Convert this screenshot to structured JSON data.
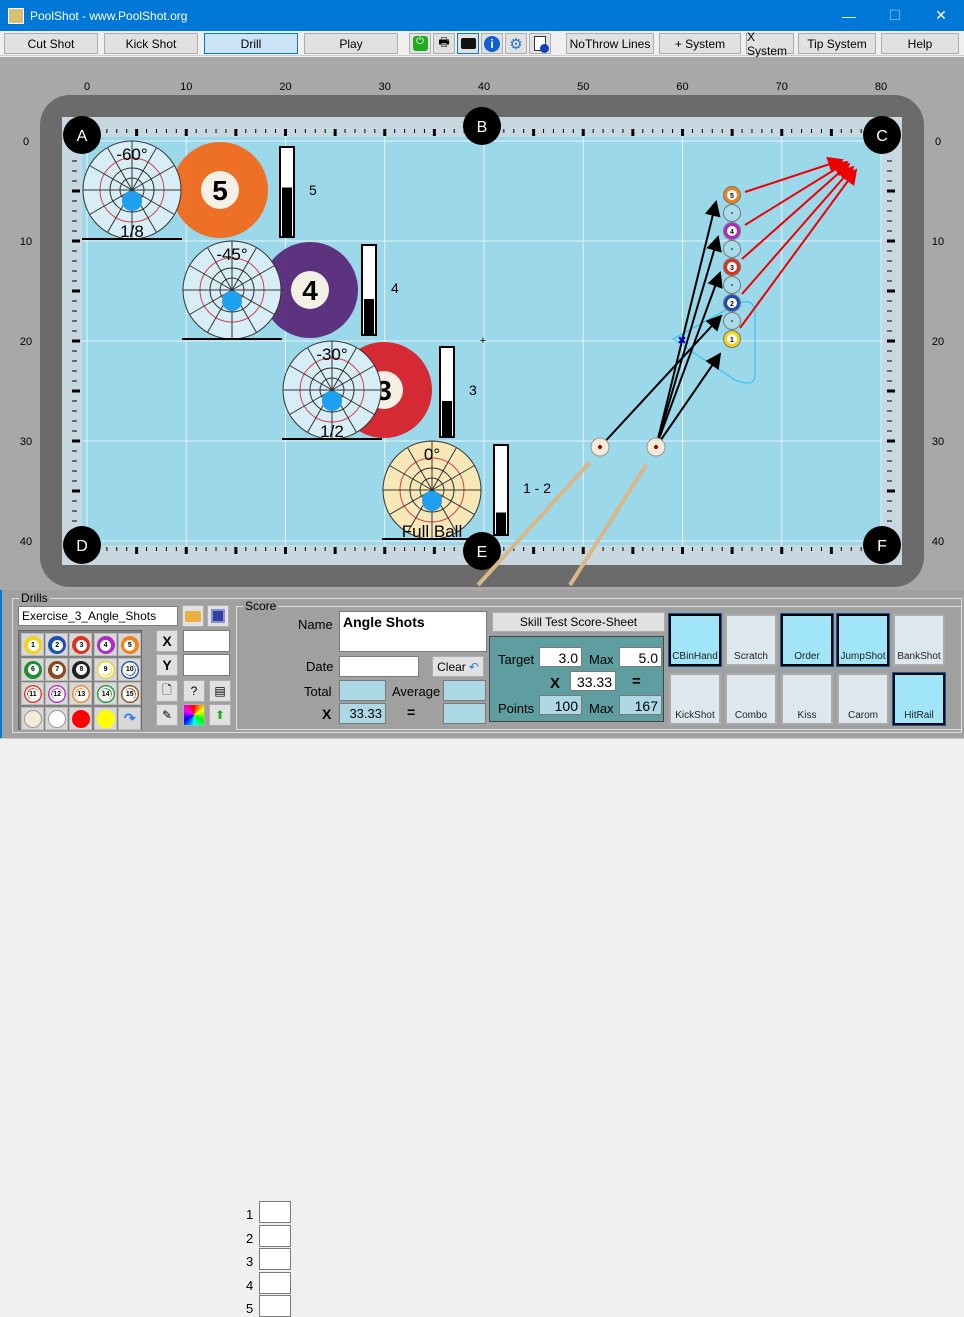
{
  "window": {
    "title": "PoolShot - www.PoolShot.org",
    "min": "—",
    "max": "☐",
    "close": "✕"
  },
  "toolbar": {
    "buttons": [
      "Cut Shot",
      "Kick Shot",
      "Drill",
      "Play"
    ],
    "active": "Drill",
    "icons": [
      "power-icon",
      "printer-icon",
      "camera-icon",
      "info-icon",
      "gear-icon",
      "help-document-icon"
    ],
    "right_buttons": [
      "NoThrow Lines",
      "+ System",
      "X System",
      "Tip System",
      "Help"
    ]
  },
  "table": {
    "x_ticks": [
      "0",
      "10",
      "20",
      "30",
      "40",
      "50",
      "60",
      "70",
      "80"
    ],
    "y_ticks": [
      "0",
      "10",
      "20",
      "30",
      "40"
    ],
    "pockets": [
      "A",
      "B",
      "C",
      "D",
      "E",
      "F"
    ],
    "felt_color": "#9ad8ea",
    "angle_diagrams": [
      {
        "angle": "-60°",
        "fraction": "1/8",
        "ball": "5",
        "ball_color": "#f26a1b",
        "bar_fill": 0.55,
        "bar_label": "5"
      },
      {
        "angle": "-45°",
        "fraction": "",
        "ball": "4",
        "ball_color": "#5a2a7a",
        "bar_fill": 0.4,
        "bar_label": "4"
      },
      {
        "angle": "-30°",
        "fraction": "1/2",
        "ball": "3",
        "ball_color": "#d8202a",
        "bar_fill": 0.4,
        "bar_label": "3"
      },
      {
        "angle": "0°",
        "fraction": "Full Ball",
        "ball": "",
        "ball_color": "#f2b030",
        "bar_fill": 0.25,
        "bar_label": "1 - 2"
      }
    ],
    "object_balls": [
      "5",
      "",
      "4",
      "",
      "3",
      "",
      "2",
      "",
      "1"
    ]
  },
  "drills": {
    "legend": "Drills",
    "file": "Exercise_3_Angle_Shots",
    "x_label": "X",
    "y_label": "Y",
    "x_value": "",
    "y_value": "",
    "balls": [
      "1",
      "2",
      "3",
      "4",
      "5",
      "6",
      "7",
      "8",
      "9",
      "10",
      "11",
      "12",
      "13",
      "14",
      "15"
    ],
    "ball_colors": [
      "#f2d21b",
      "#1f4fb4",
      "#e0301e",
      "#b02cc0",
      "#f2801b",
      "#20902e",
      "#8a4a1c",
      "#222222",
      "#f2d21b",
      "#1f4fb4",
      "#e0301e",
      "#b02cc0",
      "#f2801b",
      "#20902e",
      "#8a4a1c"
    ]
  },
  "score": {
    "legend": "Score",
    "rows": [
      "1",
      "2",
      "3",
      "4",
      "5"
    ],
    "name_label": "Name",
    "name": "Angle Shots",
    "date_label": "Date",
    "date": "",
    "clear": "Clear",
    "total_label": "Total",
    "average_label": "Average",
    "x_label": "X",
    "x_value": "33.33",
    "eq": "="
  },
  "skill": {
    "title": "Skill Test Score-Sheet",
    "target_label": "Target",
    "target": "3.0",
    "max_label": "Max",
    "max": "5.0",
    "x": "X",
    "mult": "33.33",
    "eq": "=",
    "points_label": "Points",
    "points": "100",
    "points_max_label": "Max",
    "points_max": "167"
  },
  "skills": [
    {
      "label": "CBinHand",
      "on": true
    },
    {
      "label": "Scratch",
      "on": false
    },
    {
      "label": "Order",
      "on": true
    },
    {
      "label": "JumpShot",
      "on": true
    },
    {
      "label": "BankShot",
      "on": false
    },
    {
      "label": "KickShot",
      "on": false
    },
    {
      "label": "Combo",
      "on": false
    },
    {
      "label": "Kiss",
      "on": false
    },
    {
      "label": "Carom",
      "on": false
    },
    {
      "label": "HitRail",
      "on": true
    }
  ]
}
